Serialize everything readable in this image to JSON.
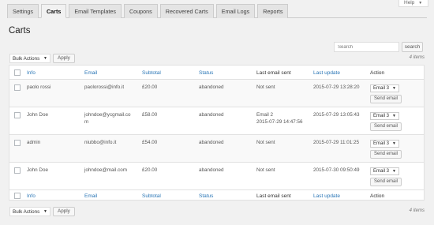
{
  "help": {
    "label": "Help",
    "icon": "triangle-down-icon"
  },
  "tabs": [
    {
      "label": "Settings",
      "active": false
    },
    {
      "label": "Carts",
      "active": true
    },
    {
      "label": "Email Templates",
      "active": false
    },
    {
      "label": "Coupons",
      "active": false
    },
    {
      "label": "Recovered Carts",
      "active": false
    },
    {
      "label": "Email Logs",
      "active": false
    },
    {
      "label": "Reports",
      "active": false
    }
  ],
  "page_title": "Carts",
  "search": {
    "placeholder": "Search",
    "button_label": "search"
  },
  "bulk_actions": {
    "selected": "Bulk Actions",
    "apply_label": "Apply"
  },
  "items_count": "4 items",
  "columns": {
    "info": "Info",
    "email": "Email",
    "subtotal": "Subtotal",
    "status": "Status",
    "last_email_sent": "Last email sent",
    "last_update": "Last update",
    "action": "Action"
  },
  "rows": [
    {
      "info": "paolo rossi",
      "email_l1": "paolorossi@info.it",
      "email_l2": "",
      "subtotal": "£20.00",
      "status": "abandoned",
      "last_sent_l1": "Not sent",
      "last_sent_l2": "",
      "last_update": "2015-07-29 13:28:20",
      "email_select": "Email 3",
      "send_label": "Send email"
    },
    {
      "info": "John Doe",
      "email_l1": "johndoe@ycgmail.co",
      "email_l2": "m",
      "subtotal": "£58.00",
      "status": "abandoned",
      "last_sent_l1": "Email 2",
      "last_sent_l2": "2015-07-29 14:47:56",
      "last_update": "2015-07-29 13:05:43",
      "email_select": "Email 3",
      "send_label": "Send email"
    },
    {
      "info": "admin",
      "email_l1": "niubbo@info.it",
      "email_l2": "",
      "subtotal": "£54.00",
      "status": "abandoned",
      "last_sent_l1": "Not sent",
      "last_sent_l2": "",
      "last_update": "2015-07-29 11:01:25",
      "email_select": "Email 3",
      "send_label": "Send email"
    },
    {
      "info": "John Doe",
      "email_l1": "johndoe@mail.com",
      "email_l2": "",
      "subtotal": "£20.00",
      "status": "abandoned",
      "last_sent_l1": "Not sent",
      "last_sent_l2": "",
      "last_update": "2015-07-30 09:50:49",
      "email_select": "Email 3",
      "send_label": "Send email"
    }
  ],
  "colors": {
    "link": "#2a76b6",
    "background": "#f1f1f1",
    "active_tab": "#f1f1f1",
    "inactive_tab": "#e4e4e4"
  }
}
